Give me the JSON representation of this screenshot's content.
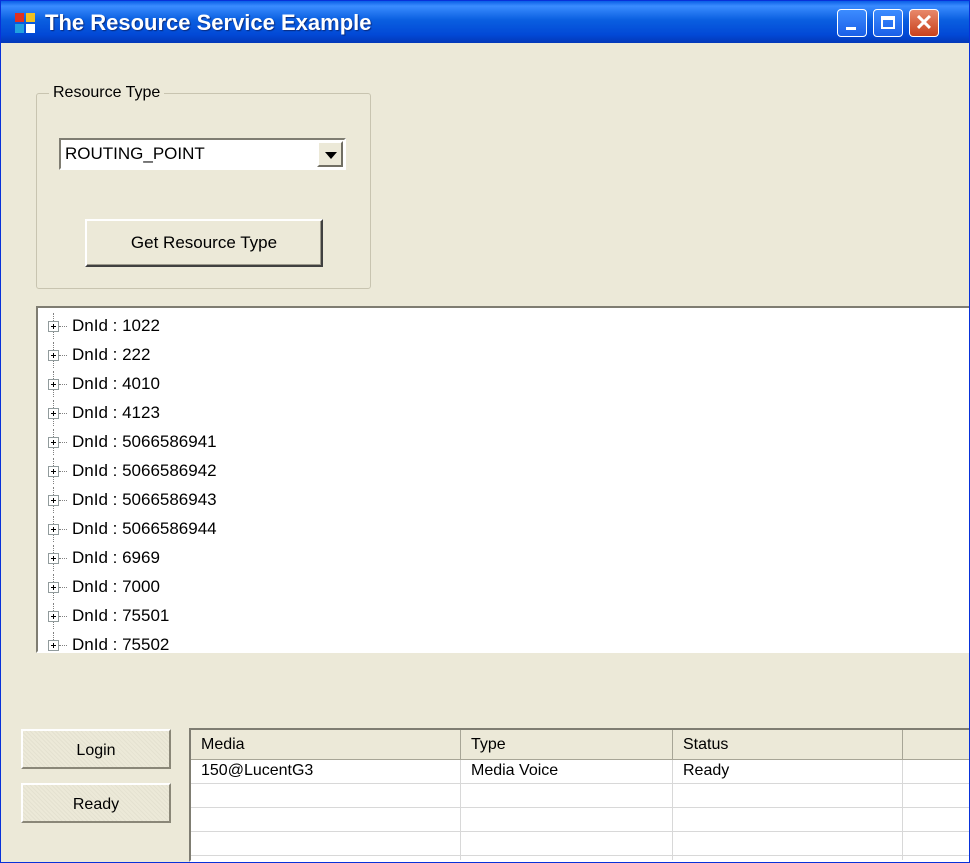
{
  "window": {
    "title": "The Resource Service Example"
  },
  "resource_group": {
    "label": "Resource Type",
    "combo_value": "ROUTING_POINT",
    "button_label": "Get Resource Type"
  },
  "tree": {
    "items": [
      "DnId : 1022",
      "DnId : 222",
      "DnId : 4010",
      "DnId : 4123",
      "DnId : 5066586941",
      "DnId : 5066586942",
      "DnId : 5066586943",
      "DnId : 5066586944",
      "DnId : 6969",
      "DnId : 7000",
      "DnId : 75501",
      "DnId : 75502"
    ]
  },
  "side_buttons": {
    "login": "Login",
    "ready": "Ready"
  },
  "grid": {
    "columns": [
      "Media",
      "Type",
      "Status"
    ],
    "rows": [
      [
        "150@LucentG3",
        "Media Voice",
        "Ready"
      ]
    ]
  }
}
